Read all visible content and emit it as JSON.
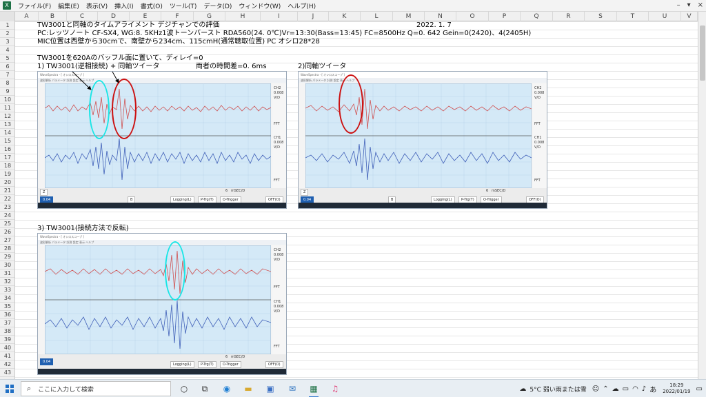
{
  "menu": {
    "items": [
      "ファイル(F)",
      "編集(E)",
      "表示(V)",
      "挿入(I)",
      "書式(O)",
      "ツール(T)",
      "データ(D)",
      "ウィンドウ(W)",
      "ヘルプ(H)"
    ],
    "right_controls": [
      "–",
      "▾",
      "×"
    ]
  },
  "columns": [
    "A",
    "B",
    "C",
    "D",
    "E",
    "F",
    "G",
    "H",
    "I",
    "J",
    "K",
    "L",
    "M",
    "N",
    "O",
    "P",
    "Q",
    "R",
    "S",
    "T",
    "U",
    "V"
  ],
  "rows": [
    "1",
    "2",
    "3",
    "4",
    "5",
    "6",
    "7",
    "8",
    "9",
    "10",
    "11",
    "12",
    "13",
    "14",
    "15",
    "16",
    "17",
    "18",
    "19",
    "20",
    "21",
    "22",
    "23",
    "24",
    "25",
    "26",
    "27",
    "28",
    "29",
    "30",
    "31",
    "32",
    "33",
    "34",
    "35",
    "36",
    "37",
    "38",
    "39",
    "40",
    "41",
    "42",
    "43"
  ],
  "cells": {
    "title": "TW3001と同軸のタイムアライメント デジチャンでの評価",
    "date": "2022. 1. 7",
    "line2": "PC:レッツノート CF-SX4, WG:8. 5KHz1波トーンバースト RDA560(24. 0℃)Vr=13:30(Bass=13:45) FC=8500Hz Q=0. 642 Gein=0(2420)、4(2405H)",
    "line3": "MIC位置は西壁から30cmで、南壁から234cm、115cmH(通常聴取位置) PC オシロ28*28",
    "line5": "TW3001を620Aのバッフル面に置いて、ディレイ=0",
    "case1": "1) TW3001(逆相接続) + 同軸ツイータ",
    "time_diff": "両者の時間差=0. 6ms",
    "case2": "2)同軸ツイータ",
    "case3": "3) TW3001(接続方法で反転)"
  },
  "scope": {
    "titlebar": "WaveSpectra - [ オシロスコープ ]",
    "toolbar": "波形解析 パラメータ 計測 設定 表示 ヘルプ",
    "ch2_label": "CH2",
    "ch1_label": "CH1",
    "scale": "0.008",
    "unit": "V/D",
    "fft": "FFT",
    "time_label": "mSEC/D",
    "time_value": "6",
    "logging": "Logging(L)",
    "ptrig": "P-Trg(T)",
    "otrigger": "O-Trigger",
    "off": "OFF(O)",
    "z_btn": "Z",
    "b_btn": "B",
    "speed": "0.04"
  },
  "taskbar": {
    "search_placeholder": "ここに入力して検索",
    "weather": "5°C 弱い雨または雪",
    "ime": "あ",
    "time": "18:29",
    "date": "2022/01/19"
  },
  "colors": {
    "red_trace": "#d05050",
    "blue_trace": "#3f5fb8",
    "cyan_ring": "#19e6e6",
    "red_ring": "#cc1111",
    "scope_bg": "#d4e9f7"
  }
}
